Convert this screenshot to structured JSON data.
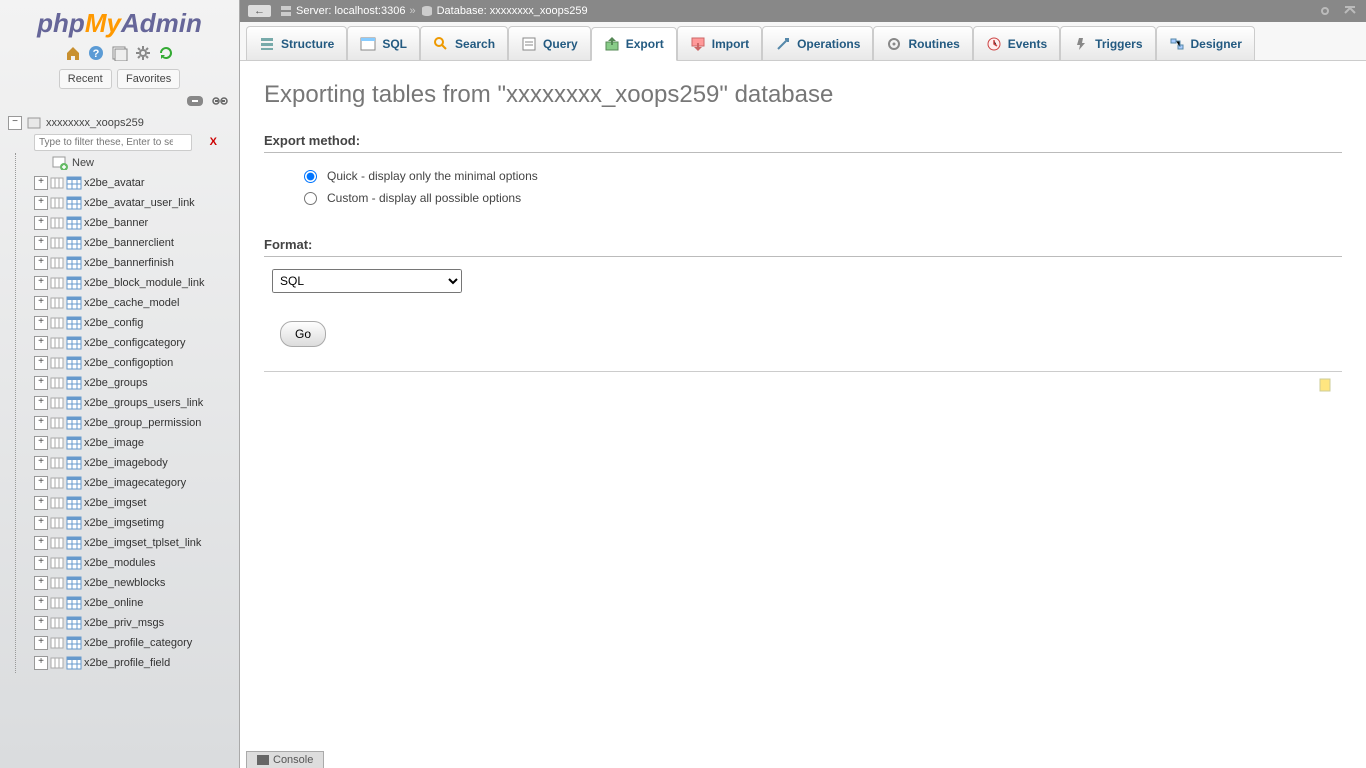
{
  "logo": {
    "p1": "php",
    "p2": "My",
    "p3": "Admin"
  },
  "recent_label": "Recent",
  "favorites_label": "Favorites",
  "breadcrumb": {
    "back": "←",
    "server_label": "Server: localhost:3306",
    "db_label": "Database: xxxxxxxx_xoops259",
    "sep": "»"
  },
  "tabs": [
    {
      "label": "Structure",
      "key": "structure"
    },
    {
      "label": "SQL",
      "key": "sql"
    },
    {
      "label": "Search",
      "key": "search"
    },
    {
      "label": "Query",
      "key": "query"
    },
    {
      "label": "Export",
      "key": "export",
      "active": true
    },
    {
      "label": "Import",
      "key": "import"
    },
    {
      "label": "Operations",
      "key": "operations"
    },
    {
      "label": "Routines",
      "key": "routines"
    },
    {
      "label": "Events",
      "key": "events"
    },
    {
      "label": "Triggers",
      "key": "triggers"
    },
    {
      "label": "Designer",
      "key": "designer"
    }
  ],
  "heading": "Exporting tables from \"xxxxxxxx_xoops259\" database",
  "export_method_title": "Export method:",
  "export_quick": "Quick - display only the minimal options",
  "export_custom": "Custom - display all possible options",
  "format_title": "Format:",
  "format_value": "SQL",
  "go_label": "Go",
  "console_label": "Console",
  "db_name": "xxxxxxxx_xoops259",
  "filter_placeholder": "Type to filter these, Enter to search all",
  "filter_clear": "X",
  "new_label": "New",
  "tables": [
    "x2be_avatar",
    "x2be_avatar_user_link",
    "x2be_banner",
    "x2be_bannerclient",
    "x2be_bannerfinish",
    "x2be_block_module_link",
    "x2be_cache_model",
    "x2be_config",
    "x2be_configcategory",
    "x2be_configoption",
    "x2be_groups",
    "x2be_groups_users_link",
    "x2be_group_permission",
    "x2be_image",
    "x2be_imagebody",
    "x2be_imagecategory",
    "x2be_imgset",
    "x2be_imgsetimg",
    "x2be_imgset_tplset_link",
    "x2be_modules",
    "x2be_newblocks",
    "x2be_online",
    "x2be_priv_msgs",
    "x2be_profile_category",
    "x2be_profile_field"
  ]
}
